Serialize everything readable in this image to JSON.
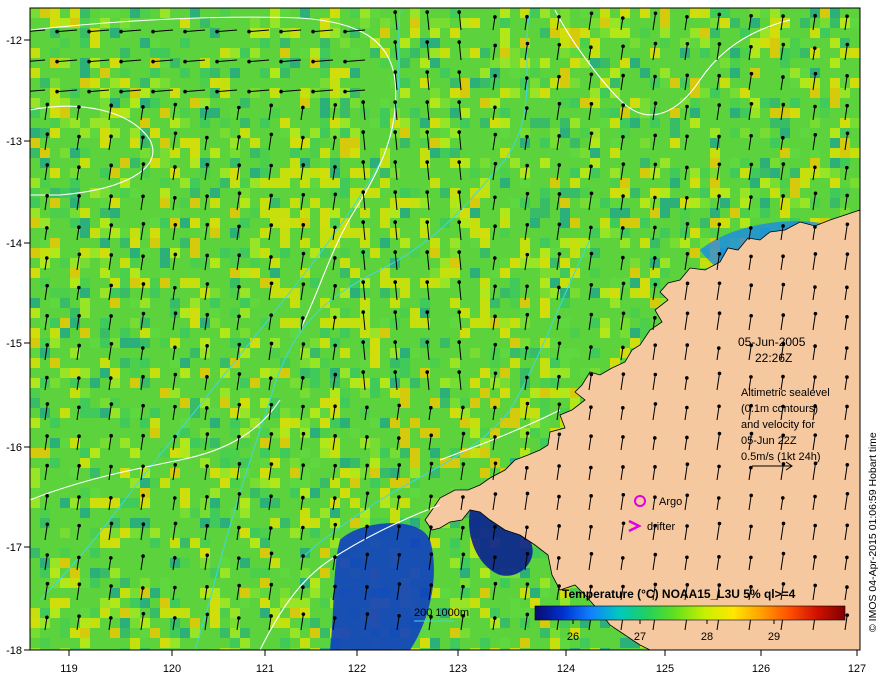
{
  "map": {
    "lon_ticks": [
      "119",
      "120",
      "121",
      "122",
      "123",
      "124",
      "125",
      "126",
      "127"
    ],
    "lat_ticks": [
      "-12",
      "-13",
      "-14",
      "-15",
      "-16",
      "-17",
      "-18"
    ],
    "date": "05-Jun-2005",
    "time": "22:26Z",
    "altimetry_lines": [
      "Altimetric sealevel",
      "(0.1m contours)",
      "and velocity for",
      "05-Jun 22Z",
      "0.5m/s (1kt 24h)"
    ],
    "argo_label": "Argo",
    "drifter_label": "drifter",
    "bathymetry_label": "200  1000m",
    "colorbar": {
      "title": "Temperature (°C) NOAA15_L3U 5% ql>=4",
      "ticks": [
        "26",
        "27",
        "28",
        "29"
      ],
      "colors": [
        "#0a0a6e",
        "#0030d0",
        "#1080ff",
        "#00c8c0",
        "#20d060",
        "#60e020",
        "#c8f000",
        "#ffe600",
        "#ffa000",
        "#ff5000",
        "#d01000",
        "#800000"
      ]
    },
    "credit": "© IMOS 04-Apr-2015 01:06:59 Hobart time",
    "colors": {
      "land": "#f5c8a0",
      "sea_base": "#5cd23c",
      "argo": "#e000e0",
      "contour": "#ffffff",
      "isobath": "#40d8e0"
    }
  }
}
